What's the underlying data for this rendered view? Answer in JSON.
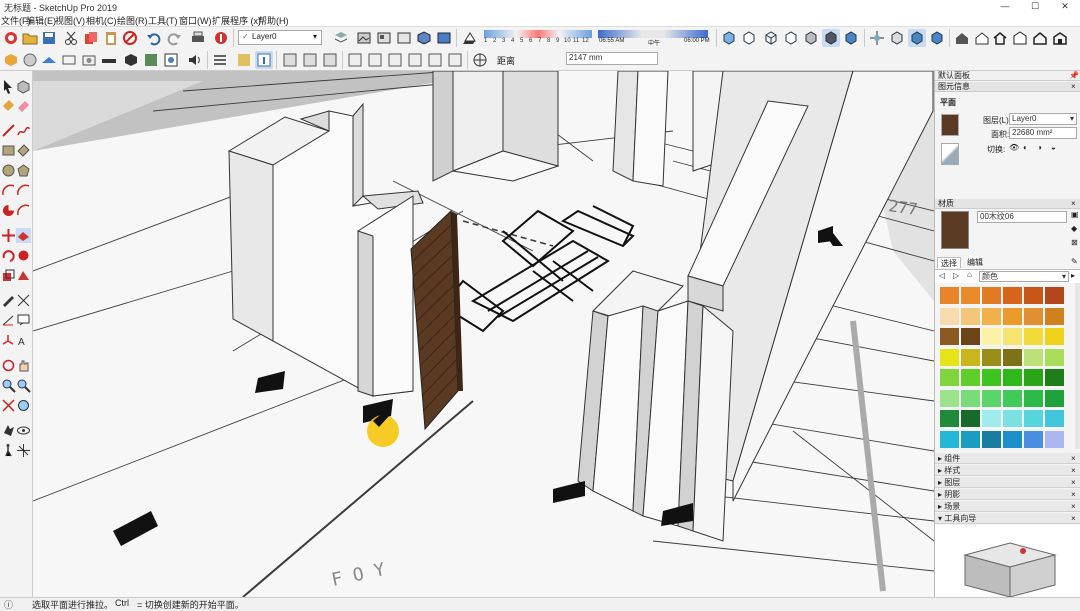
{
  "app": {
    "title": "无标题 - SketchUp Pro 2019",
    "window_controls": [
      "—",
      "☐",
      "✕"
    ]
  },
  "menu": [
    "文件(F)",
    "编辑(E)",
    "视图(V)",
    "相机(C)",
    "绘图(R)",
    "工具(T)",
    "窗口(W)",
    "扩展程序 (x)",
    "帮助(H)"
  ],
  "toolbar1": {
    "layer_value": "Layer0",
    "shadow_months": [
      "1",
      "2",
      "3",
      "4",
      "5",
      "6",
      "7",
      "8",
      "9",
      "10",
      "11",
      "12"
    ],
    "time_start": "06:55 AM",
    "time_mid": "中午",
    "time_end": "06:00 PM"
  },
  "toolbar2": {
    "distance_label": "距离",
    "distance_value": "2147 mm"
  },
  "right_panel": {
    "tray_title": "默认面板",
    "entity_info": {
      "header": "图元信息",
      "entity_type": "平面",
      "layer_label": "图层(L):",
      "layer_value": "Layer0",
      "area_label": "面积:",
      "area_value": "22680 mm²",
      "toggle_label": "切换:"
    },
    "materials": {
      "header": "材质",
      "name": "00木纹06",
      "tab_select": "选择",
      "tab_edit": "编辑",
      "category": "颜色"
    },
    "sections": [
      "组件",
      "样式",
      "图层",
      "阴影",
      "场景",
      "工具向导"
    ]
  },
  "swatches": [
    [
      "#e8852a",
      "#e88a2c",
      "#e07a24",
      "#d8641c",
      "#c8561a",
      "#b3461a"
    ],
    [
      "#f7dcb0",
      "#f3c77a",
      "#f0b14a",
      "#e89b2a",
      "#e09030",
      "#cf8120"
    ],
    [
      "#8a5a22",
      "#6b4418",
      "#fbf2a6",
      "#f5e570",
      "#f1da3a",
      "#efd21c"
    ],
    [
      "#e7e51a",
      "#c9b51c",
      "#9a8e1a",
      "#7d7218",
      "#bde07a",
      "#a8dc5a"
    ],
    [
      "#7ed63c",
      "#5fce2a",
      "#3ec41e",
      "#2fb81a",
      "#2aa51a",
      "#1d7d17"
    ],
    [
      "#9be48c",
      "#78dd78",
      "#5bd468",
      "#41c95a",
      "#2dba4a",
      "#1fa23a"
    ],
    [
      "#1f8a3a",
      "#176a2c",
      "#a0ecec",
      "#7ae0e0",
      "#56d6dc",
      "#42c4da"
    ],
    [
      "#23b8d8",
      "#1a9dc0",
      "#1a7da0",
      "#1c8fc8",
      "#4a8ee0",
      "#a9b6f0"
    ]
  ],
  "status": {
    "hint1": "选取平面进行推拉。",
    "key": "Ctrl",
    "hint2": "= 切换创建新的开始平面。"
  },
  "colors": {
    "wall_top": "#f4f4f4",
    "wall_side": "#d6d6d6",
    "wood": "#5a3a22",
    "highlight": "#f5c400"
  }
}
